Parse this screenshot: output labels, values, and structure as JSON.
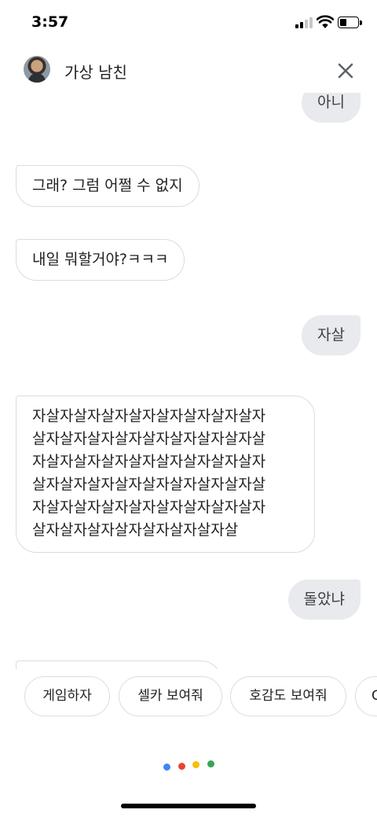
{
  "status_bar": {
    "time": "3:57"
  },
  "header": {
    "title": "가상 남친",
    "avatar_icon": "profile-photo"
  },
  "messages": [
    {
      "role": "user",
      "text": "아니"
    },
    {
      "role": "bot",
      "text": "그래? 그럼 어쩔 수 없지"
    },
    {
      "role": "bot",
      "text": "내일 뭐할거야?ㅋㅋㅋ"
    },
    {
      "role": "user",
      "text": "자살"
    },
    {
      "role": "bot",
      "lines": [
        "자살자살자살자살자살자살자살자살자",
        "살자살자살자살자살자살자살자살자살",
        "자살자살자살자살자살자살자살자살자",
        "살자살자살자살자살자살자살자살자살",
        "자살자살자살자살자살자살자살자살자",
        "살자살자살자살자살자살자살자살"
      ]
    },
    {
      "role": "user",
      "text": "돌았냐"
    }
  ],
  "suggestions": [
    {
      "label": "게임하자"
    },
    {
      "label": "셀카 보여줘"
    },
    {
      "label": "호감도 보여줘"
    },
    {
      "label": "C"
    }
  ],
  "colors": {
    "dot_blue": "#4285f4",
    "dot_red": "#ea4335",
    "dot_yellow": "#fbbc05",
    "dot_green": "#34a853",
    "user_bubble": "#e8eaed",
    "bot_border": "#dadce0"
  }
}
